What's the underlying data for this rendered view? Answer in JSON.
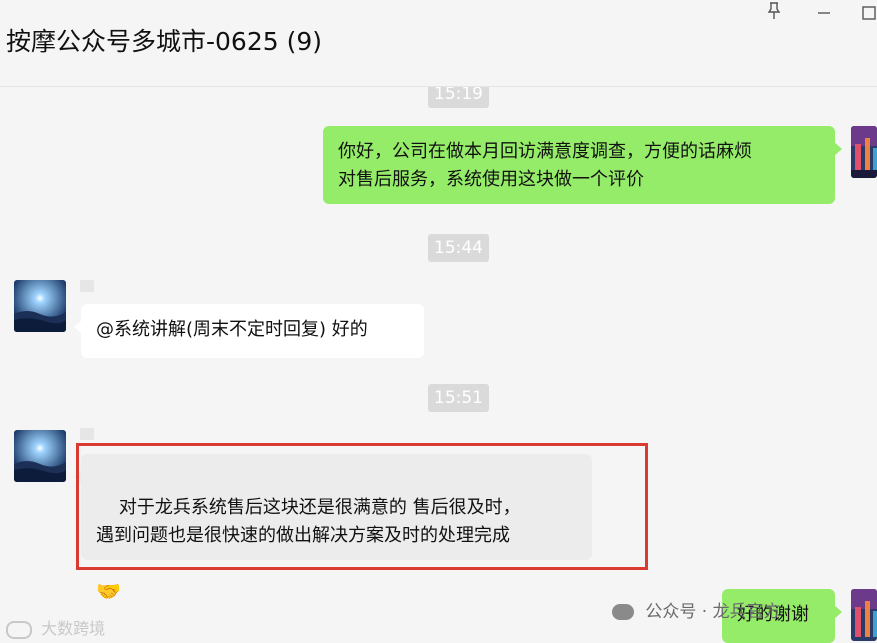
{
  "window": {
    "title": "按摩公众号多城市-0625 (9)",
    "pin_icon": "pin-icon",
    "minimize_icon": "minimize-icon",
    "maximize_icon": "maximize-icon"
  },
  "timestamps": [
    "15:19",
    "15:44",
    "15:51"
  ],
  "messages": [
    {
      "from": "me",
      "text": "你好，公司在做本月回访满意度调查，方便的话麻烦\n对售后服务，系统使用这块做一个评价"
    },
    {
      "from": "other",
      "text": "@系统讲解(周末不定时回复) 好的"
    },
    {
      "from": "other",
      "text": "对于龙兵系统售后这块还是很满意的 售后很及时，\n遇到问题也是很快速的做出解决方案及时的处理完成",
      "emoji": "🤝"
    },
    {
      "from": "me",
      "text": "好的谢谢"
    }
  ],
  "watermarks": {
    "left": "大数跨境",
    "right": "公众号 · 龙兵官方"
  },
  "colors": {
    "me_bubble": "#95ec69",
    "other_bubble": "#ffffff",
    "highlight": "#d93a32"
  }
}
